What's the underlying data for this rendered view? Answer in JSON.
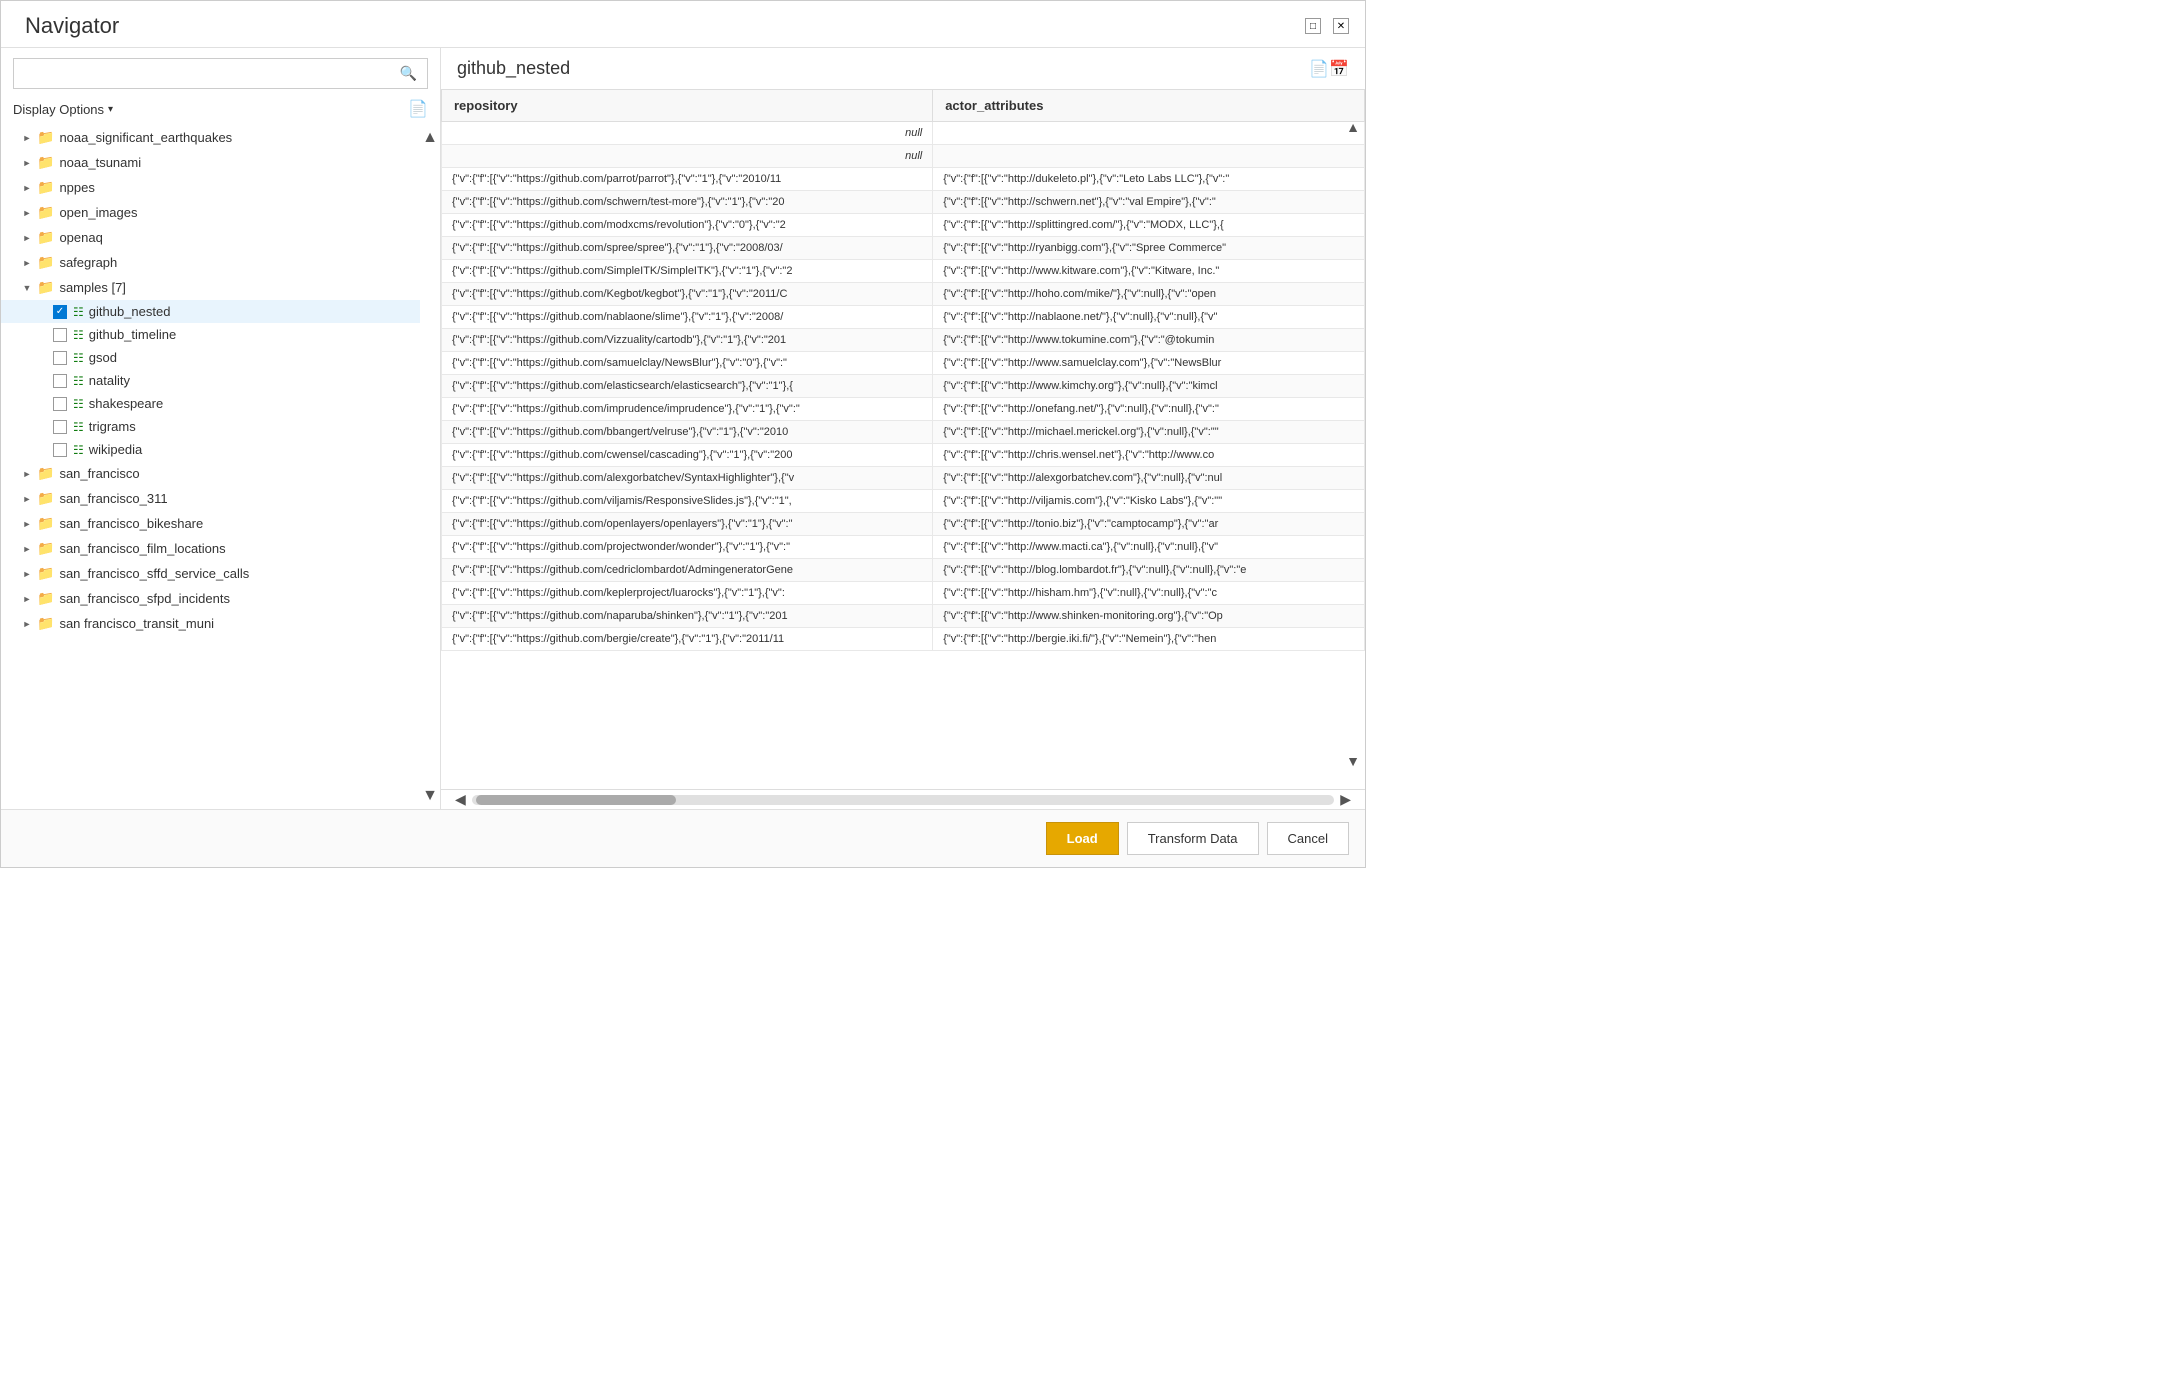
{
  "window": {
    "title": "Navigator",
    "controls": [
      "restore",
      "close"
    ]
  },
  "search": {
    "placeholder": ""
  },
  "display_options": {
    "label": "Display Options",
    "arrow": "▾"
  },
  "tree": {
    "items": [
      {
        "id": "noaa_sig",
        "label": "noaa_significant_earthquakes",
        "type": "folder",
        "indent": 1,
        "expanded": false,
        "partial": true
      },
      {
        "id": "noaa_tsunami",
        "label": "noaa_tsunami",
        "type": "folder",
        "indent": 1,
        "expanded": false
      },
      {
        "id": "nppes",
        "label": "nppes",
        "type": "folder",
        "indent": 1,
        "expanded": false
      },
      {
        "id": "open_images",
        "label": "open_images",
        "type": "folder",
        "indent": 1,
        "expanded": false
      },
      {
        "id": "openaq",
        "label": "openaq",
        "type": "folder",
        "indent": 1,
        "expanded": false
      },
      {
        "id": "safegraph",
        "label": "safegraph",
        "type": "folder",
        "indent": 1,
        "expanded": false
      },
      {
        "id": "samples",
        "label": "samples [7]",
        "type": "folder",
        "indent": 1,
        "expanded": true
      },
      {
        "id": "github_nested",
        "label": "github_nested",
        "type": "table",
        "indent": 2,
        "checked": true,
        "selected": true
      },
      {
        "id": "github_timeline",
        "label": "github_timeline",
        "type": "table",
        "indent": 2,
        "checked": false
      },
      {
        "id": "gsod",
        "label": "gsod",
        "type": "table",
        "indent": 2,
        "checked": false
      },
      {
        "id": "natality",
        "label": "natality",
        "type": "table",
        "indent": 2,
        "checked": false
      },
      {
        "id": "shakespeare",
        "label": "shakespeare",
        "type": "table",
        "indent": 2,
        "checked": false
      },
      {
        "id": "trigrams",
        "label": "trigrams",
        "type": "table",
        "indent": 2,
        "checked": false
      },
      {
        "id": "wikipedia",
        "label": "wikipedia",
        "type": "table",
        "indent": 2,
        "checked": false
      },
      {
        "id": "san_francisco",
        "label": "san_francisco",
        "type": "folder",
        "indent": 1,
        "expanded": false
      },
      {
        "id": "san_francisco_311",
        "label": "san_francisco_311",
        "type": "folder",
        "indent": 1,
        "expanded": false
      },
      {
        "id": "san_francisco_bikeshare",
        "label": "san_francisco_bikeshare",
        "type": "folder",
        "indent": 1,
        "expanded": false
      },
      {
        "id": "san_francisco_film",
        "label": "san_francisco_film_locations",
        "type": "folder",
        "indent": 1,
        "expanded": false
      },
      {
        "id": "san_francisco_sffd",
        "label": "san_francisco_sffd_service_calls",
        "type": "folder",
        "indent": 1,
        "expanded": false
      },
      {
        "id": "san_francisco_sfpd",
        "label": "san_francisco_sfpd_incidents",
        "type": "folder",
        "indent": 1,
        "expanded": false
      },
      {
        "id": "san_francisco_transit",
        "label": "san francisco_transit_muni",
        "type": "folder",
        "indent": 1,
        "expanded": false
      }
    ]
  },
  "preview": {
    "title": "github_nested",
    "columns": [
      "repository",
      "actor_attributes"
    ],
    "rows": [
      [
        "null",
        ""
      ],
      [
        "null",
        ""
      ],
      [
        "{\"v\":{\"f\":[{\"v\":\"https://github.com/parrot/parrot\"},{\"v\":\"1\"},{\"v\":\"2010/11",
        "{\"v\":{\"f\":[{\"v\":\"http://dukeleto.pl\"},{\"v\":\"Leto Labs LLC\"},{\"v\":\""
      ],
      [
        "{\"v\":{\"f\":[{\"v\":\"https://github.com/schwern/test-more\"},{\"v\":\"1\"},{\"v\":\"20",
        "{\"v\":{\"f\":[{\"v\":\"http://schwern.net\"},{\"v\":\"val Empire\"},{\"v\":\""
      ],
      [
        "{\"v\":{\"f\":[{\"v\":\"https://github.com/modxcms/revolution\"},{\"v\":\"0\"},{\"v\":\"2",
        "{\"v\":{\"f\":[{\"v\":\"http://splittingred.com/\"},{\"v\":\"MODX, LLC\"},{"
      ],
      [
        "{\"v\":{\"f\":[{\"v\":\"https://github.com/spree/spree\"},{\"v\":\"1\"},{\"v\":\"2008/03/",
        "{\"v\":{\"f\":[{\"v\":\"http://ryanbigg.com\"},{\"v\":\"Spree Commerce\""
      ],
      [
        "{\"v\":{\"f\":[{\"v\":\"https://github.com/SimpleITK/SimpleITK\"},{\"v\":\"1\"},{\"v\":\"2",
        "{\"v\":{\"f\":[{\"v\":\"http://www.kitware.com\"},{\"v\":\"Kitware, Inc.\""
      ],
      [
        "{\"v\":{\"f\":[{\"v\":\"https://github.com/Kegbot/kegbot\"},{\"v\":\"1\"},{\"v\":\"2011/C",
        "{\"v\":{\"f\":[{\"v\":\"http://hoho.com/mike/\"},{\"v\":null},{\"v\":\"open"
      ],
      [
        "{\"v\":{\"f\":[{\"v\":\"https://github.com/nablaone/slime\"},{\"v\":\"1\"},{\"v\":\"2008/",
        "{\"v\":{\"f\":[{\"v\":\"http://nablaone.net/\"},{\"v\":null},{\"v\":null},{\"v\""
      ],
      [
        "{\"v\":{\"f\":[{\"v\":\"https://github.com/Vizzuality/cartodb\"},{\"v\":\"1\"},{\"v\":\"201",
        "{\"v\":{\"f\":[{\"v\":\"http://www.tokumine.com\"},{\"v\":\"@tokumin"
      ],
      [
        "{\"v\":{\"f\":[{\"v\":\"https://github.com/samuelclay/NewsBlur\"},{\"v\":\"0\"},{\"v\":\"",
        "{\"v\":{\"f\":[{\"v\":\"http://www.samuelclay.com\"},{\"v\":\"NewsBlur"
      ],
      [
        "{\"v\":{\"f\":[{\"v\":\"https://github.com/elasticsearch/elasticsearch\"},{\"v\":\"1\"},{",
        "{\"v\":{\"f\":[{\"v\":\"http://www.kimchy.org\"},{\"v\":null},{\"v\":\"kimcl"
      ],
      [
        "{\"v\":{\"f\":[{\"v\":\"https://github.com/imprudence/imprudence\"},{\"v\":\"1\"},{\"v\":\"",
        "{\"v\":{\"f\":[{\"v\":\"http://onefang.net/\"},{\"v\":null},{\"v\":null},{\"v\":\""
      ],
      [
        "{\"v\":{\"f\":[{\"v\":\"https://github.com/bbangert/velruse\"},{\"v\":\"1\"},{\"v\":\"2010",
        "{\"v\":{\"f\":[{\"v\":\"http://michael.merickel.org\"},{\"v\":null},{\"v\":\"\""
      ],
      [
        "{\"v\":{\"f\":[{\"v\":\"https://github.com/cwensel/cascading\"},{\"v\":\"1\"},{\"v\":\"200",
        "{\"v\":{\"f\":[{\"v\":\"http://chris.wensel.net\"},{\"v\":\"http://www.co"
      ],
      [
        "{\"v\":{\"f\":[{\"v\":\"https://github.com/alexgorbatchev/SyntaxHighlighter\"},{\"v",
        "{\"v\":{\"f\":[{\"v\":\"http://alexgorbatchev.com\"},{\"v\":null},{\"v\":nul"
      ],
      [
        "{\"v\":{\"f\":[{\"v\":\"https://github.com/viljamis/ResponsiveSlides.js\"},{\"v\":\"1\",",
        "{\"v\":{\"f\":[{\"v\":\"http://viljamis.com\"},{\"v\":\"Kisko Labs\"},{\"v\":\"\""
      ],
      [
        "{\"v\":{\"f\":[{\"v\":\"https://github.com/openlayers/openlayers\"},{\"v\":\"1\"},{\"v\":\"",
        "{\"v\":{\"f\":[{\"v\":\"http://tonio.biz\"},{\"v\":\"camptocamp\"},{\"v\":\"ar"
      ],
      [
        "{\"v\":{\"f\":[{\"v\":\"https://github.com/projectwonder/wonder\"},{\"v\":\"1\"},{\"v\":\"",
        "{\"v\":{\"f\":[{\"v\":\"http://www.macti.ca\"},{\"v\":null},{\"v\":null},{\"v\""
      ],
      [
        "{\"v\":{\"f\":[{\"v\":\"https://github.com/cedriclombardot/AdmingeneratorGene",
        "{\"v\":{\"f\":[{\"v\":\"http://blog.lombardot.fr\"},{\"v\":null},{\"v\":null},{\"v\":\"e"
      ],
      [
        "{\"v\":{\"f\":[{\"v\":\"https://github.com/keplerproject/luarocks\"},{\"v\":\"1\"},{\"v\":",
        "{\"v\":{\"f\":[{\"v\":\"http://hisham.hm\"},{\"v\":null},{\"v\":null},{\"v\":\"c"
      ],
      [
        "{\"v\":{\"f\":[{\"v\":\"https://github.com/naparuba/shinken\"},{\"v\":\"1\"},{\"v\":\"201",
        "{\"v\":{\"f\":[{\"v\":\"http://www.shinken-monitoring.org\"},{\"v\":\"Op"
      ],
      [
        "{\"v\":{\"f\":[{\"v\":\"https://github.com/bergie/create\"},{\"v\":\"1\"},{\"v\":\"2011/11",
        "{\"v\":{\"f\":[{\"v\":\"http://bergie.iki.fi/\"},{\"v\":\"Nemein\"},{\"v\":\"hen"
      ]
    ]
  },
  "footer": {
    "load_label": "Load",
    "transform_label": "Transform Data",
    "cancel_label": "Cancel"
  }
}
